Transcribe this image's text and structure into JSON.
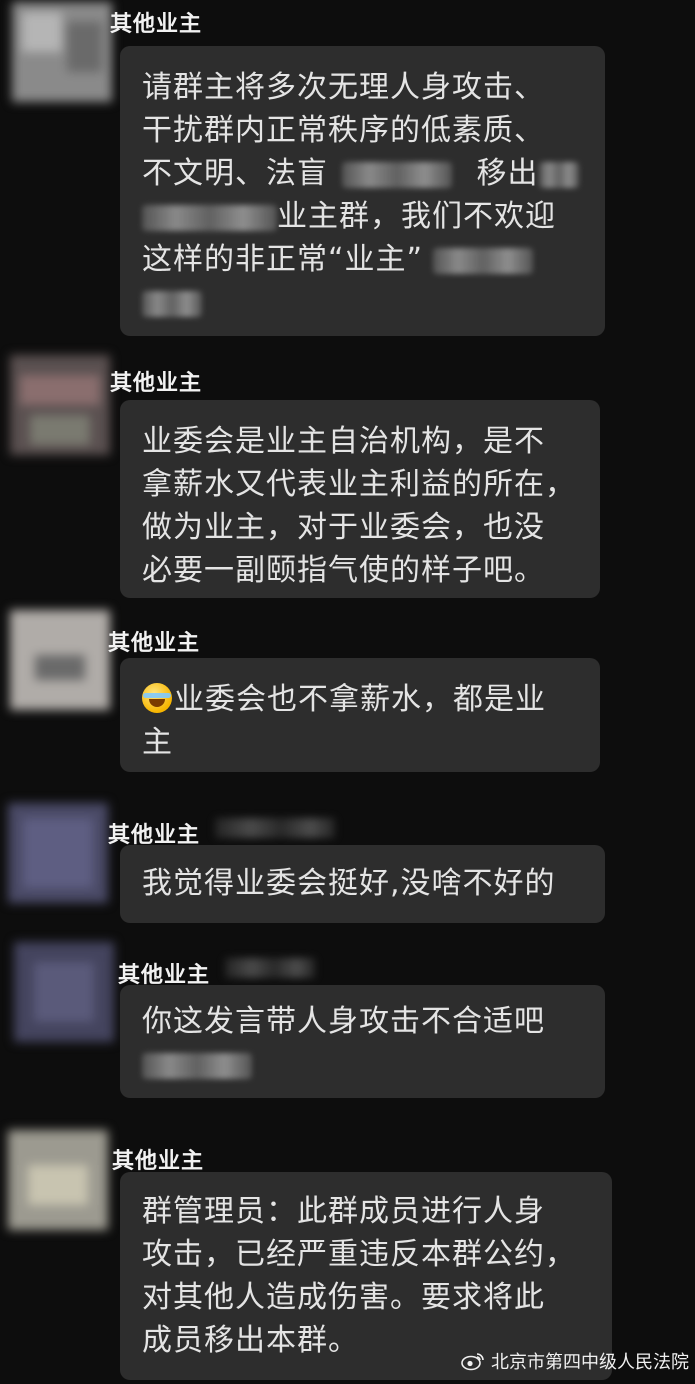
{
  "messages": [
    {
      "sender": "其他业主",
      "lines": [
        {
          "text": "请群主将多次无理人身攻击、"
        },
        {
          "text": "干扰群内正常秩序的低素质、"
        },
        {
          "text": "不文明、法盲",
          "blur_after": 1,
          "text2": " 移出"
        },
        {
          "text": "业主群，我们不欢迎",
          "blur_before": 1
        },
        {
          "text": "这样的非正常“业主”",
          "blur_after": 1
        },
        {
          "text": "",
          "blur_after": 1
        }
      ]
    },
    {
      "sender": "其他业主",
      "lines": [
        {
          "text": "业委会是业主自治机构，是不"
        },
        {
          "text": "拿薪水又代表业主利益的所在，"
        },
        {
          "text": "做为业主，对于业委会，也没"
        },
        {
          "text": "必要一副颐指气使的样子吧。"
        }
      ]
    },
    {
      "sender": "其他业主",
      "emoji": "laughing-crying-emoji",
      "lines": [
        {
          "text": "业委会也不拿薪水，都是业"
        },
        {
          "text": "主"
        }
      ]
    },
    {
      "sender": "其他业主",
      "lines": [
        {
          "text": "我觉得业委会挺好,没啥不好的"
        }
      ]
    },
    {
      "sender": "其他业主",
      "lines": [
        {
          "text": "你这发言带人身攻击不合适吧"
        },
        {
          "text": "",
          "blur_after": 1
        }
      ]
    },
    {
      "sender": "其他业主",
      "lines": [
        {
          "text": "群管理员：此群成员进行人身"
        },
        {
          "text": "攻击，已经严重违反本群公约，"
        },
        {
          "text": "对其他人造成伤害。要求将此"
        },
        {
          "text": "成员移出本群。"
        }
      ]
    }
  ],
  "watermark": {
    "icon": "weibo-icon",
    "text": "北京市第四中级人民法院"
  },
  "colors": {
    "background": "#0d0d0d",
    "bubble": "#2d2d2d",
    "text": "#e4e4e4"
  }
}
